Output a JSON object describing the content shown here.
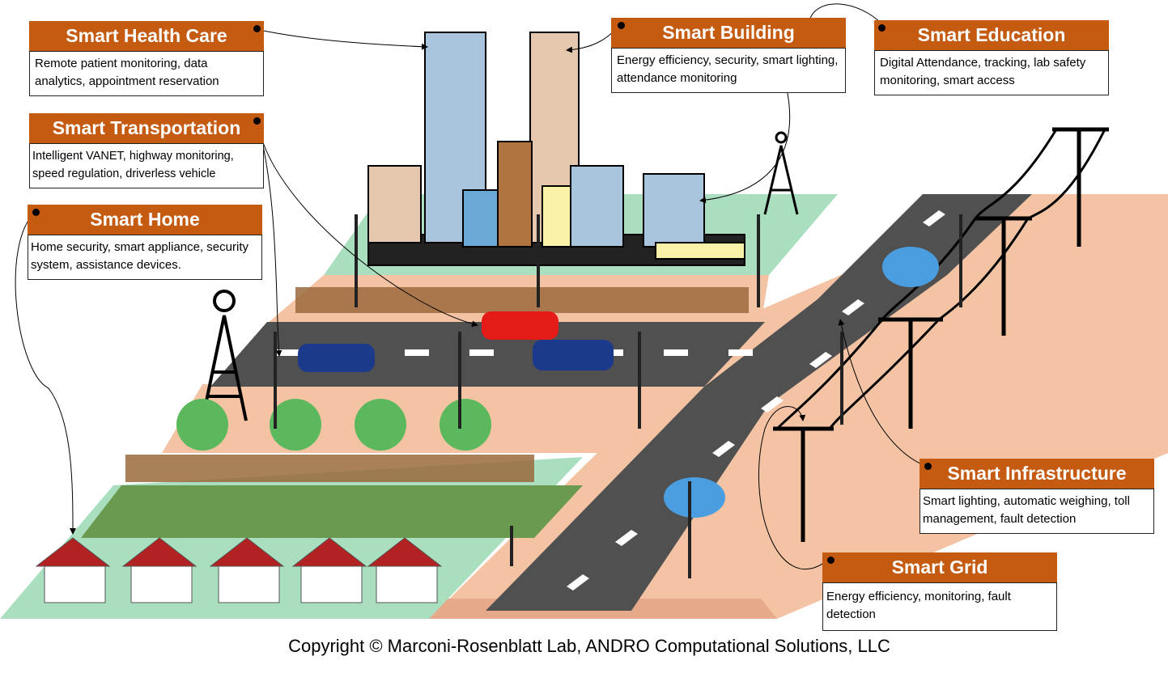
{
  "colors": {
    "header": "#c55a11",
    "road": "#505050",
    "green": "#a9dfbf",
    "peach": "#f4c3a3"
  },
  "cards": [
    {
      "id": "health",
      "title": "Smart Health Care",
      "body": "Remote patient monitoring, data analytics, appointment reservation"
    },
    {
      "id": "building",
      "title": "Smart Building",
      "body": "Energy efficiency, security, smart lighting, attendance monitoring"
    },
    {
      "id": "education",
      "title": "Smart Education",
      "body": "Digital Attendance, tracking, lab safety monitoring, smart access"
    },
    {
      "id": "transportation",
      "title": "Smart Transportation",
      "body": "Intelligent VANET, highway monitoring, speed regulation, driverless vehicle"
    },
    {
      "id": "home",
      "title": "Smart Home",
      "body": "Home security, smart appliance, security system, assistance devices."
    },
    {
      "id": "infrastructure",
      "title": "Smart Infrastructure",
      "body": "Smart lighting, automatic weighing, toll management, fault detection"
    },
    {
      "id": "grid",
      "title": "Smart Grid",
      "body": "Energy efficiency, monitoring, fault detection"
    }
  ],
  "copyright": "Copyright © Marconi-Rosenblatt Lab, ANDRO Computational Solutions, LLC"
}
